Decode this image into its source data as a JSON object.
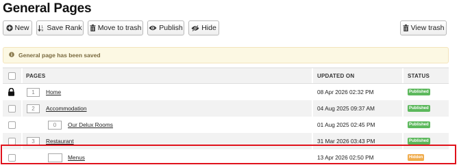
{
  "page": {
    "title": "General Pages"
  },
  "toolbar": {
    "new_label": "New",
    "save_rank_label": "Save Rank",
    "move_to_trash_label": "Move to trash",
    "publish_label": "Publish",
    "hide_label": "Hide",
    "view_trash_label": "View trash"
  },
  "alert": {
    "message": "General page has been saved"
  },
  "table": {
    "headers": {
      "pages": "PAGES",
      "updated_on": "UPDATED ON",
      "status": "STATUS"
    },
    "rows": [
      {
        "rank": "1",
        "title": "Home",
        "updated": "08 Apr 2026 02:32 PM",
        "status": "Published",
        "locked": true,
        "level": 0
      },
      {
        "rank": "2",
        "title": "Accommodation",
        "updated": "04 Aug 2025 09:37 AM",
        "status": "Published",
        "locked": false,
        "level": 0
      },
      {
        "rank": "0",
        "title": "Our Delux Rooms",
        "updated": "01 Aug 2025 02:45 PM",
        "status": "Published",
        "locked": false,
        "level": 1
      },
      {
        "rank": "3",
        "title": "Restaurant",
        "updated": "31 Mar 2026 03:43 PM",
        "status": "Published",
        "locked": false,
        "level": 0
      },
      {
        "rank": "",
        "title": "Menus",
        "updated": "13 Apr 2026 02:50 PM",
        "status": "Hidden",
        "locked": false,
        "level": 1
      }
    ]
  },
  "colors": {
    "published": "#5cb85c",
    "hidden": "#f0ad4e",
    "highlight_border": "#e0101a",
    "alert_bg": "#fcf8e3"
  },
  "icons": {
    "new": "plus-circle-icon",
    "save_rank": "sort-icon",
    "move_to_trash": "trash-icon",
    "publish": "eye-icon",
    "hide": "eye-slash-icon",
    "view_trash": "trash-icon",
    "alert": "info-circle-icon",
    "lock": "lock-icon"
  }
}
